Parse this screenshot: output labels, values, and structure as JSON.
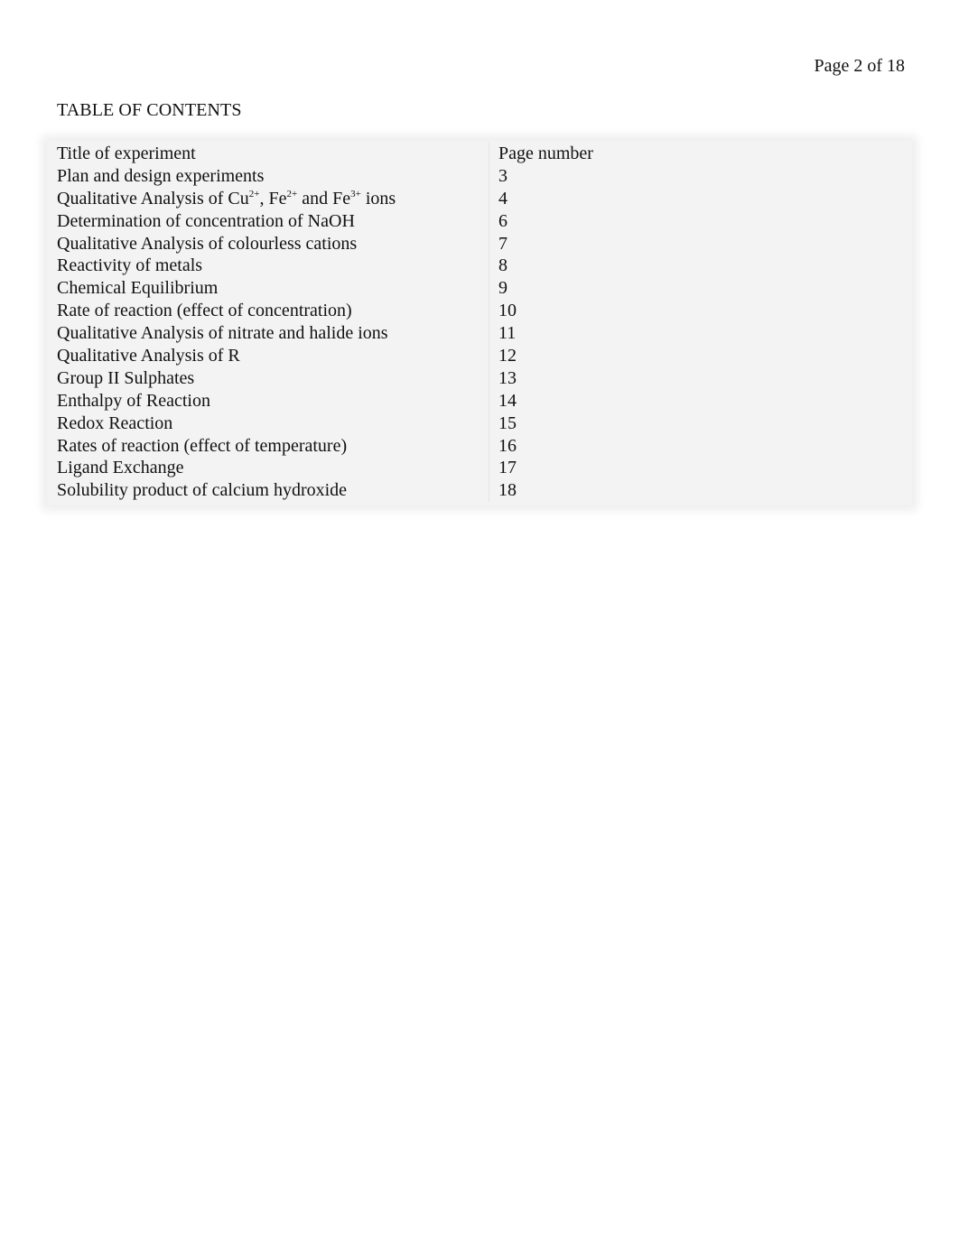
{
  "header": {
    "page_indicator": "Page 2 of 18"
  },
  "toc": {
    "title": "TABLE OF CONTENTS",
    "columns": [
      "Title of experiment",
      "Page number"
    ],
    "rows": [
      {
        "title": "Plan and design experiments",
        "page": "3"
      },
      {
        "title_parts": [
          "Qualitative Analysis of Cu",
          "2+",
          ", Fe",
          "2+",
          " and Fe",
          "3+",
          " ions"
        ],
        "title": "Qualitative Analysis of Cu2+, Fe2+ and Fe3+ ions",
        "page": "4"
      },
      {
        "title": "Determination of concentration of NaOH",
        "page": "6"
      },
      {
        "title": "Qualitative Analysis of colourless cations",
        "page": "7"
      },
      {
        "title": "Reactivity of metals",
        "page": "8"
      },
      {
        "title": "Chemical Equilibrium",
        "page": "9"
      },
      {
        "title": "Rate of reaction (effect of concentration)",
        "page": "10"
      },
      {
        "title": "Qualitative Analysis of nitrate and halide ions",
        "page": "11"
      },
      {
        "title": "Qualitative Analysis of R",
        "page": "12"
      },
      {
        "title": "Group II Sulphates",
        "page": "13"
      },
      {
        "title": "Enthalpy of Reaction",
        "page": "14"
      },
      {
        "title": "Redox Reaction",
        "page": "15"
      },
      {
        "title": "Rates of reaction (effect of temperature)",
        "page": "16"
      },
      {
        "title": "Ligand Exchange",
        "page": "17"
      },
      {
        "title": "Solubility product of calcium hydroxide",
        "page": "18"
      }
    ]
  }
}
